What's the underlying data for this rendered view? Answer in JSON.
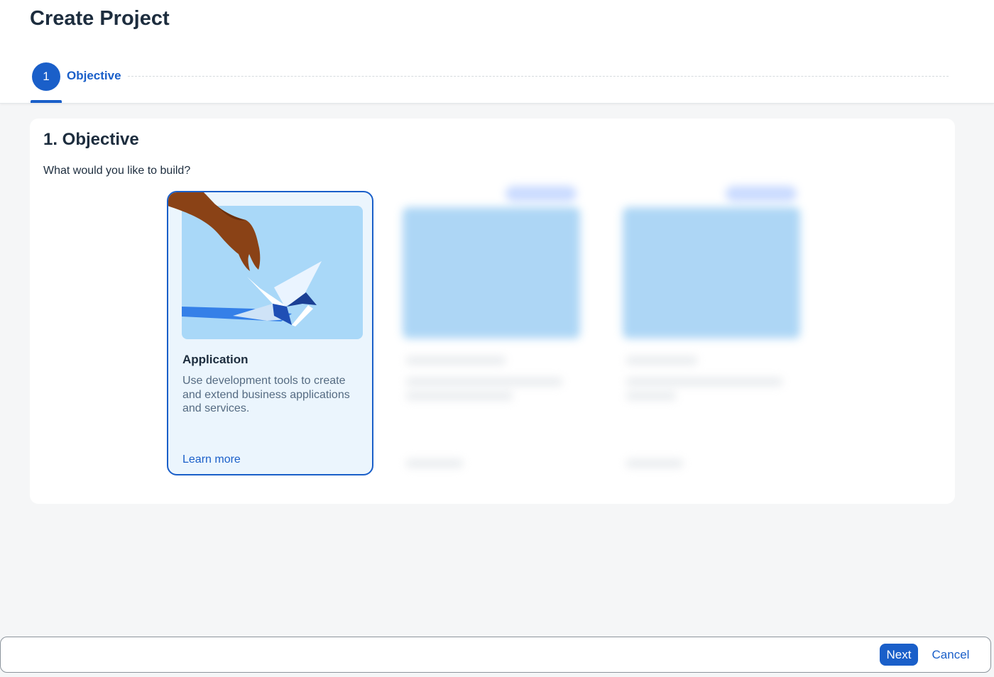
{
  "page": {
    "title": "Create Project"
  },
  "wizard": {
    "steps": [
      {
        "number": "1",
        "label": "Objective"
      }
    ]
  },
  "section": {
    "title": "1. Objective",
    "question": "What would you like to build?"
  },
  "cards": [
    {
      "title": "Application",
      "description": "Use development tools to create and extend business applications and services.",
      "link": "Learn more",
      "illustration": "hand-folding-paper-crane",
      "selected": true
    }
  ],
  "footer": {
    "next_label": "Next",
    "cancel_label": "Cancel"
  },
  "colors": {
    "accent": "#1a5fc9",
    "card_selected_bg": "#ebf5fd",
    "illustration_bg": "#a9d8f8"
  }
}
